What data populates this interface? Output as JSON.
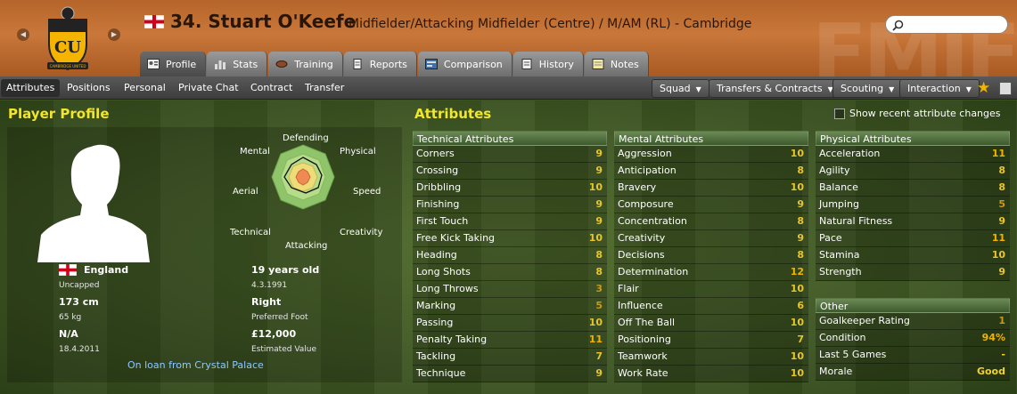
{
  "header": {
    "title": "34. Stuart O'Keefe",
    "subtitle": "Midfielder/Attacking Midfielder (Centre) / M/AM (RL) - Cambridge",
    "watermark": "FMIF",
    "badge_text": "CU",
    "badge_caption": "CAMBRIDGE UNITED",
    "nav_back": "◀",
    "nav_forward": "▶",
    "search": {
      "placeholder": ""
    }
  },
  "tabs": [
    {
      "label": "Profile",
      "icon": "profile-icon",
      "active": true
    },
    {
      "label": "Stats",
      "icon": "stats-icon"
    },
    {
      "label": "Training",
      "icon": "training-icon"
    },
    {
      "label": "Reports",
      "icon": "reports-icon"
    },
    {
      "label": "Comparison",
      "icon": "comparison-icon"
    },
    {
      "label": "History",
      "icon": "history-icon"
    },
    {
      "label": "Notes",
      "icon": "notes-icon"
    }
  ],
  "subnav": {
    "items": [
      "Attributes",
      "Positions",
      "Personal",
      "Private Chat",
      "Contract",
      "Transfer"
    ],
    "menus": [
      "Squad",
      "Transfers & Contracts",
      "Scouting",
      "Interaction"
    ],
    "star_icon": "star-icon",
    "doc_icon": "notebook-icon"
  },
  "profile": {
    "section_title": "Player Profile",
    "nationality": "England",
    "caps": "Uncapped",
    "height": "173 cm",
    "weight": "65 kg",
    "rating": "N/A",
    "rating_date": "18.4.2011",
    "age": "19 years old",
    "dob": "4.3.1991",
    "preferred_foot": "Right",
    "preferred_foot_label": "Preferred Foot",
    "value": "£12,000",
    "value_label": "Estimated Value",
    "loan": "On loan from Crystal Palace",
    "polar_labels": {
      "defending": "Defending",
      "physical": "Physical",
      "speed": "Speed",
      "creativity": "Creativity",
      "attacking": "Attacking",
      "technical": "Technical",
      "aerial": "Aerial",
      "mental": "Mental"
    }
  },
  "attributes": {
    "section_title": "Attributes",
    "recent_toggle": "Show recent attribute changes",
    "technical": {
      "title": "Technical Attributes",
      "rows": [
        {
          "name": "Corners",
          "value": "9"
        },
        {
          "name": "Crossing",
          "value": "9"
        },
        {
          "name": "Dribbling",
          "value": "10"
        },
        {
          "name": "Finishing",
          "value": "9"
        },
        {
          "name": "First Touch",
          "value": "9"
        },
        {
          "name": "Free Kick Taking",
          "value": "10"
        },
        {
          "name": "Heading",
          "value": "8"
        },
        {
          "name": "Long Shots",
          "value": "8"
        },
        {
          "name": "Long Throws",
          "value": "3"
        },
        {
          "name": "Marking",
          "value": "5"
        },
        {
          "name": "Passing",
          "value": "10"
        },
        {
          "name": "Penalty Taking",
          "value": "11"
        },
        {
          "name": "Tackling",
          "value": "7"
        },
        {
          "name": "Technique",
          "value": "9"
        }
      ]
    },
    "mental": {
      "title": "Mental Attributes",
      "rows": [
        {
          "name": "Aggression",
          "value": "10"
        },
        {
          "name": "Anticipation",
          "value": "8"
        },
        {
          "name": "Bravery",
          "value": "10"
        },
        {
          "name": "Composure",
          "value": "9"
        },
        {
          "name": "Concentration",
          "value": "8"
        },
        {
          "name": "Creativity",
          "value": "9"
        },
        {
          "name": "Decisions",
          "value": "8"
        },
        {
          "name": "Determination",
          "value": "12"
        },
        {
          "name": "Flair",
          "value": "10"
        },
        {
          "name": "Influence",
          "value": "6"
        },
        {
          "name": "Off The Ball",
          "value": "10"
        },
        {
          "name": "Positioning",
          "value": "7"
        },
        {
          "name": "Teamwork",
          "value": "10"
        },
        {
          "name": "Work Rate",
          "value": "10"
        }
      ]
    },
    "physical": {
      "title": "Physical Attributes",
      "rows": [
        {
          "name": "Acceleration",
          "value": "11"
        },
        {
          "name": "Agility",
          "value": "8"
        },
        {
          "name": "Balance",
          "value": "8"
        },
        {
          "name": "Jumping",
          "value": "5"
        },
        {
          "name": "Natural Fitness",
          "value": "9"
        },
        {
          "name": "Pace",
          "value": "11"
        },
        {
          "name": "Stamina",
          "value": "10"
        },
        {
          "name": "Strength",
          "value": "9"
        }
      ]
    },
    "other": {
      "title": "Other",
      "rows": [
        {
          "name": "Goalkeeper Rating",
          "value": "1"
        },
        {
          "name": "Condition",
          "value": "94%"
        },
        {
          "name": "Last 5 Games",
          "value": "-"
        },
        {
          "name": "Morale",
          "value": "Good"
        }
      ]
    }
  }
}
